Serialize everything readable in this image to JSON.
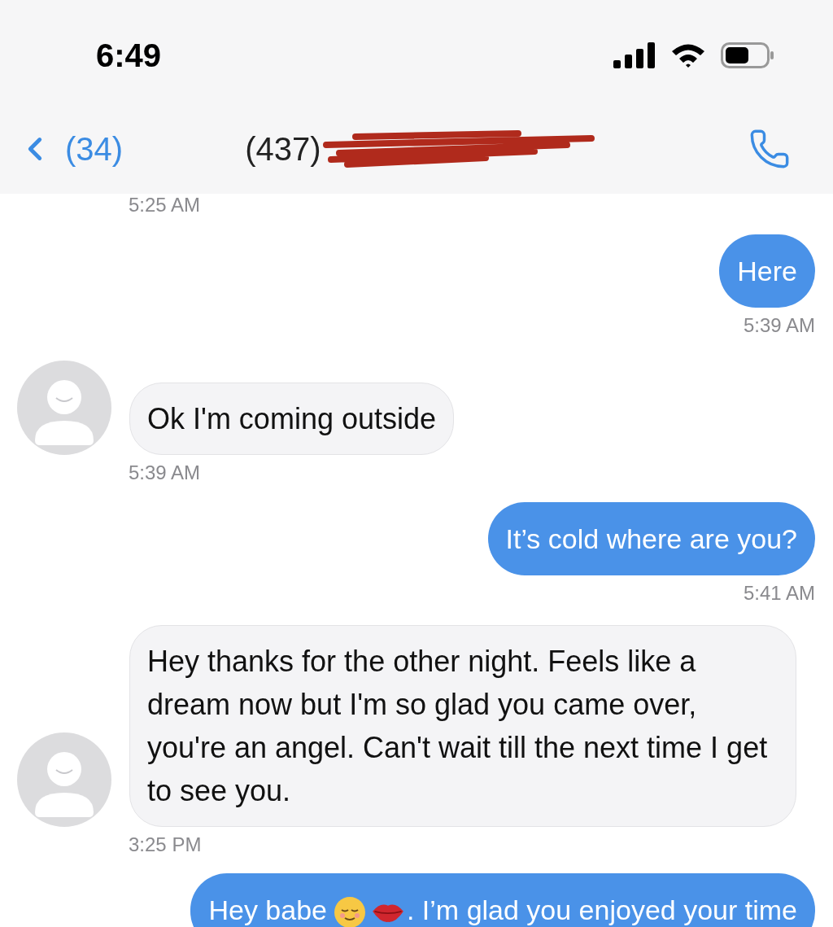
{
  "status_bar": {
    "time": "6:49"
  },
  "nav": {
    "back_count": "(34)",
    "title": "(437)",
    "title_redacted": true
  },
  "messages": [
    {
      "kind": "timestamp",
      "text": "5:25 AM"
    },
    {
      "kind": "sent",
      "text": "Here"
    },
    {
      "kind": "timestamp",
      "text": "5:39 AM"
    },
    {
      "kind": "received",
      "text": "Ok I'm coming outside"
    },
    {
      "kind": "timestamp",
      "text": "5:39 AM"
    },
    {
      "kind": "sent",
      "text": "It’s cold where are you?"
    },
    {
      "kind": "timestamp",
      "text": "5:41 AM"
    },
    {
      "kind": "received",
      "text": "Hey thanks for the other night. Feels like a dream now but I'm so glad you came over, you're an angel. Can't wait till the next time I get to see you."
    },
    {
      "kind": "timestamp",
      "text": "3:25 PM"
    },
    {
      "kind": "sent",
      "segments": [
        {
          "kind": "text",
          "text": "Hey babe"
        },
        {
          "kind": "relieved-face"
        },
        {
          "kind": "kiss-mark"
        },
        {
          "kind": "text",
          "text": ". I’m glad you enjoyed your time"
        }
      ]
    }
  ]
}
